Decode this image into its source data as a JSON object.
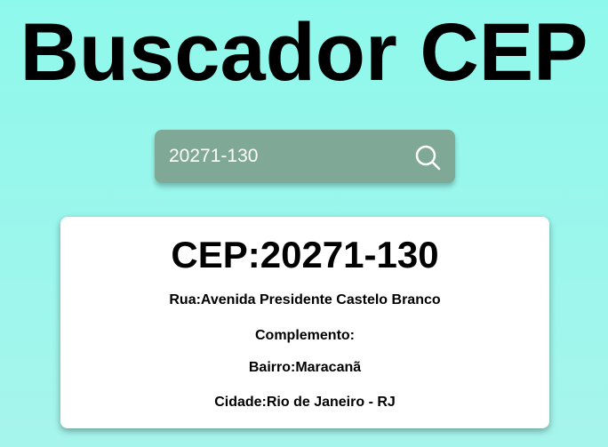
{
  "header": {
    "title": "Buscador CEP"
  },
  "search": {
    "value": "20271-130",
    "icon": "search-icon"
  },
  "result": {
    "cep_line": "CEP:20271-130",
    "rua_line": "Rua:Avenida Presidente Castelo Branco",
    "complemento_line": "Complemento:",
    "bairro_line": "Bairro:Maracanã",
    "cidade_line": "Cidade:Rio de Janeiro - RJ"
  },
  "colors": {
    "background": "#8ff8ec",
    "search_box": "#7fa996",
    "card": "#ffffff",
    "text": "#000000",
    "input_text": "#ffffff"
  }
}
